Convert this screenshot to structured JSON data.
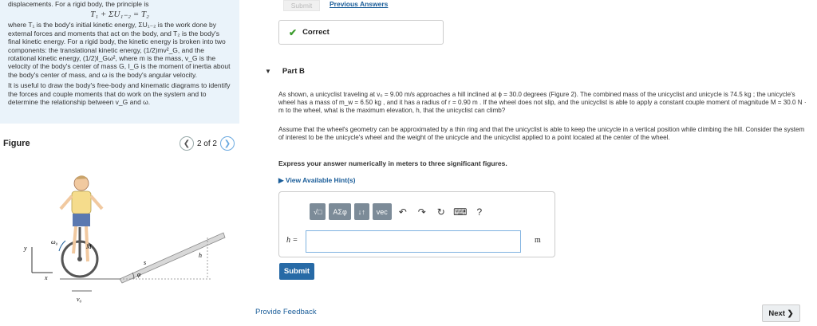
{
  "intro": {
    "line1": "displacements. For a rigid body, the principle is",
    "equation": "T₁ + ΣU₁₋₂ = T₂",
    "para1": "where T₁ is the body's initial kinetic energy, ΣU₁₋₂ is the work done by external forces and moments that act on the body, and T₂ is the body's final kinetic energy. For a rigid body, the kinetic energy is broken into two components: the translational kinetic energy, (1/2)mv²_G, and the rotational kinetic energy, (1/2)I_Gω², where m is the mass, v_G is the velocity of the body's center of mass G, I_G is the moment of inertia about the body's center of mass, and ω is the body's angular velocity.",
    "para2": "It is useful to draw the body's free-body and kinematic diagrams to identify the forces and couple moments that do work on the system and to determine the relationship between v_G and ω."
  },
  "figure": {
    "label": "Figure",
    "page": "2 of 2",
    "prev_icon": "chevron-left-icon",
    "next_icon": "chevron-right-icon",
    "labels": {
      "y": "y",
      "x": "x",
      "omega": "ω₀",
      "M": "M",
      "s": "s",
      "h": "h",
      "phi": "φ",
      "v0": "v₀"
    }
  },
  "top": {
    "submit": "Submit",
    "previous_answers": "Previous Answers"
  },
  "status": {
    "text": "Correct",
    "color": "#3c9c2e"
  },
  "part": {
    "title": "Part B"
  },
  "question": {
    "p1": "As shown, a unicyclist traveling at v₀ = 9.00 m/s approaches a hill inclined at ϕ = 30.0 degrees (Figure 2). The combined mass of the unicyclist and unicycle is 74.5 kg ; the unicycle's wheel has a mass of m_w = 6.50 kg , and it has a radius of r = 0.90 m . If the wheel does not slip, and the unicyclist is able to apply a constant couple moment of magnitude M = 30.0 N · m to the wheel, what is the maximum elevation, h, that the unicyclist can climb?",
    "p2": "Assume that the wheel's geometry can be approximated by a thin ring and that the unicyclist is able to keep the unicycle in a vertical position while climbing the hill. Consider the system of interest to be the unicycle's wheel and the weight of the unicycle and the unicyclist applied to a point located at the center of the wheel.",
    "p3": "Express your answer numerically in meters to three significant figures."
  },
  "hint": {
    "label": "View Available Hint(s)"
  },
  "toolbar": {
    "templates": "√□",
    "greek": "ΑΣφ",
    "arrows": "↓↑",
    "vec": "vec",
    "undo": "↶",
    "redo": "↷",
    "reset": "↻",
    "keyboard": "⌨",
    "help": "?"
  },
  "answer": {
    "label": "h =",
    "value": "",
    "unit": "m"
  },
  "actions": {
    "submit": "Submit",
    "feedback": "Provide Feedback",
    "next": "Next ❯"
  }
}
